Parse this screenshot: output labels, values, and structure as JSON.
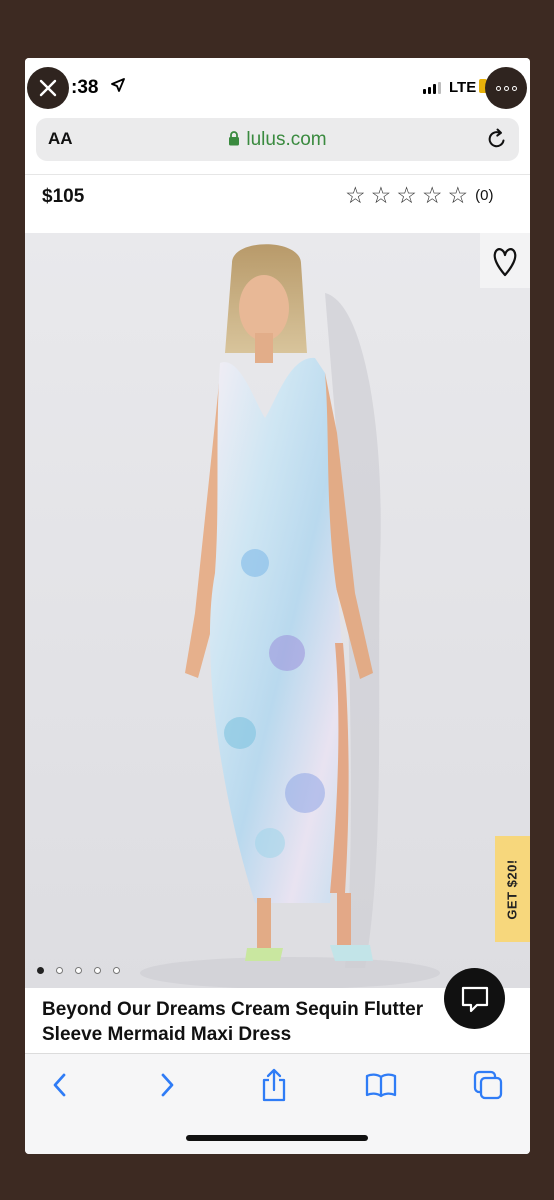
{
  "status_bar": {
    "time": ":38",
    "network": "LTE"
  },
  "address_bar": {
    "text_size_label": "AA",
    "host": "lulus.com"
  },
  "product": {
    "price": "$105",
    "rating_stars": 0,
    "review_count": "(0)",
    "title_line1": "Beyond Our Dreams Cream Sequin Flutter",
    "title_line2": "Sleeve Mermaid Maxi Dress",
    "image_dot_count": 5,
    "image_active_dot": 0
  },
  "promo": {
    "label": "GET $20!"
  },
  "icons": {
    "close": "close-icon",
    "more": "more-icon",
    "lock": "lock-icon",
    "reload": "reload-icon",
    "heart": "heart-icon",
    "chat": "chat-icon",
    "back": "back-icon",
    "forward": "forward-icon",
    "share": "share-icon",
    "bookmarks": "bookmarks-icon",
    "tabs": "tabs-icon"
  },
  "colors": {
    "frame": "#3d2a22",
    "host_green": "#3a8a3f",
    "safari_blue": "#2f7cf6",
    "promo_yellow": "#f7d77c"
  }
}
